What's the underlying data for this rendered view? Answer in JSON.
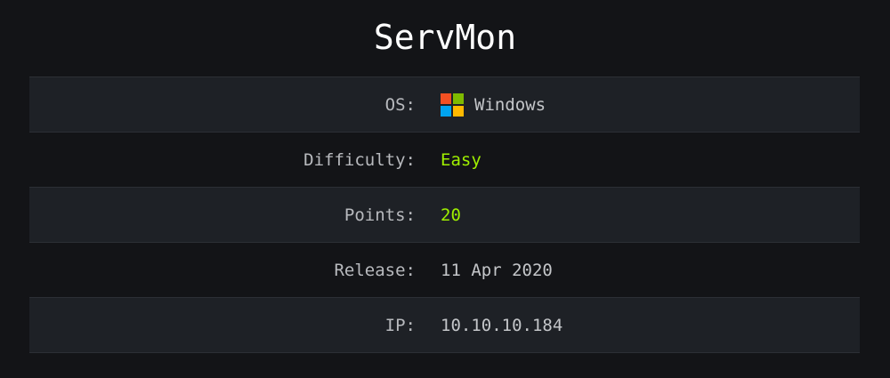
{
  "title": "ServMon",
  "rows": [
    {
      "label": "OS:",
      "value": "Windows",
      "icon": "windows-logo-icon"
    },
    {
      "label": "Difficulty:",
      "value": "Easy"
    },
    {
      "label": "Points:",
      "value": "20"
    },
    {
      "label": "Release:",
      "value": "11 Apr 2020"
    },
    {
      "label": "IP:",
      "value": "10.10.10.184"
    }
  ],
  "colors": {
    "background": "#131417",
    "stripe": "#1e2126",
    "accent_green": "#9fef00",
    "windows_logo": [
      "#f25022",
      "#7fba00",
      "#00a4ef",
      "#ffb900"
    ]
  }
}
